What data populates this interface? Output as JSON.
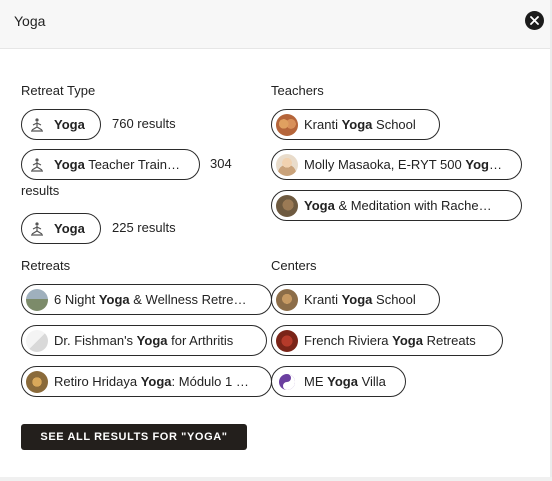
{
  "search": {
    "value": "Yoga"
  },
  "retreat_type": {
    "title": "Retreat Type",
    "items": [
      {
        "pre": "",
        "bold": "Yoga",
        "post": "",
        "count": "760 results"
      },
      {
        "pre": "",
        "bold": "Yoga",
        "post": " Teacher Train…",
        "count": "304",
        "count_wrap": "results"
      },
      {
        "pre": "",
        "bold": "Yoga",
        "post": "",
        "count": "225 results"
      }
    ]
  },
  "teachers": {
    "title": "Teachers",
    "items": [
      {
        "pre": "Kranti ",
        "bold": "Yoga",
        "post": " School"
      },
      {
        "pre": "Molly Masaoka, E-RYT 500 ",
        "bold": "Yog",
        "post": "…"
      },
      {
        "pre": "",
        "bold": "Yoga",
        "post": " & Meditation with Rache…"
      }
    ]
  },
  "retreats": {
    "title": "Retreats",
    "items": [
      {
        "pre": "6 Night ",
        "bold": "Yoga",
        "post": " & Wellness Retre…"
      },
      {
        "pre": "Dr. Fishman's ",
        "bold": "Yoga",
        "post": " for Arthritis"
      },
      {
        "pre": "Retiro Hridaya ",
        "bold": "Yoga",
        "post": ": Módulo 1 …"
      }
    ]
  },
  "centers": {
    "title": "Centers",
    "items": [
      {
        "pre": "Kranti ",
        "bold": "Yoga",
        "post": " School"
      },
      {
        "pre": "French Riviera ",
        "bold": "Yoga",
        "post": " Retreats"
      },
      {
        "pre": "ME ",
        "bold": "Yoga",
        "post": " Villa"
      }
    ]
  },
  "see_all": {
    "label": "SEE ALL RESULTS FOR \"YOGA\""
  },
  "icons": {
    "clear": "close-icon",
    "retreat_type": "yoga-pose-icon"
  },
  "colors": {
    "button_bg": "#231f1c",
    "pill_border": "#2b2b2b",
    "search_bg": "#f7f7f7"
  }
}
